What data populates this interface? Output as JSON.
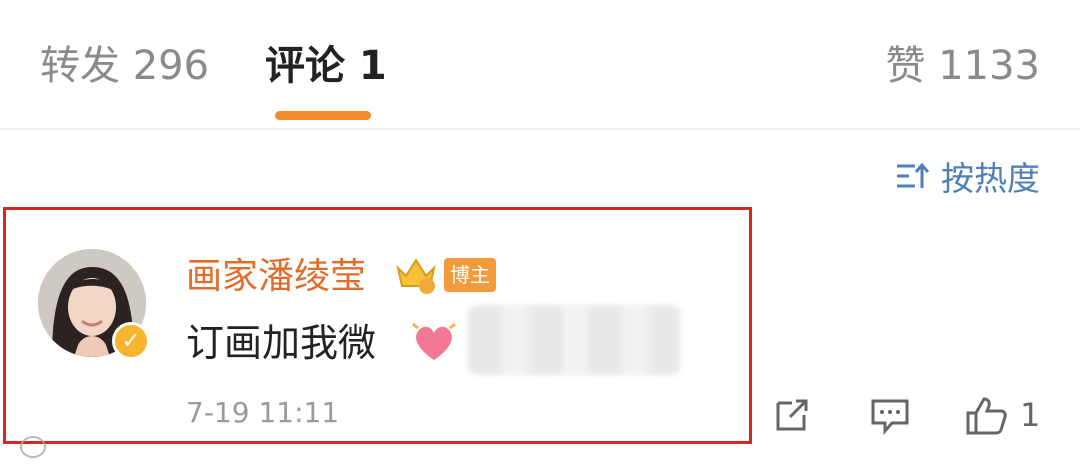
{
  "tabs": [
    {
      "label": "转发 296"
    },
    {
      "label": "评论 1"
    },
    {
      "label": "赞 1133"
    }
  ],
  "sort": {
    "label": "按热度",
    "icon": "sort-icon"
  },
  "comment": {
    "username": "画家潘绫莹",
    "badge": "博主",
    "text": "订画加我微",
    "date": "7-19 11:11",
    "likes": "1"
  },
  "colors": {
    "accent": "#f28b2c",
    "username": "#e26d2a",
    "highlight_border": "#d52622",
    "sort_link": "#4f7fb6",
    "badge_bg": "#f39a3a"
  },
  "icons": [
    "sort-icon",
    "verified-icon",
    "crown-icon",
    "heart-emoji-icon",
    "share-icon",
    "reply-icon",
    "thumbs-up-icon"
  ]
}
